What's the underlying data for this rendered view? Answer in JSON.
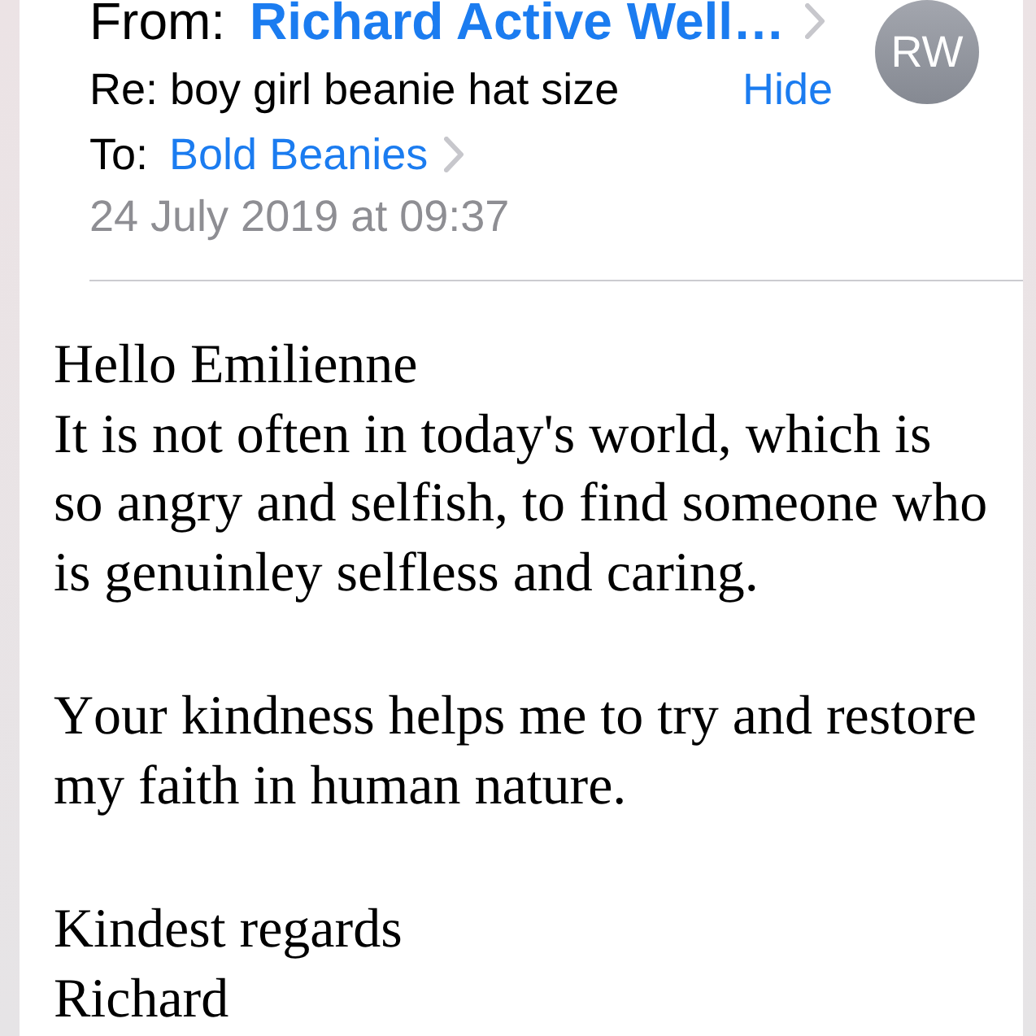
{
  "header": {
    "from": {
      "label": "From:",
      "name": "Richard Active Well…"
    },
    "subject": "Re: boy girl beanie hat size",
    "hide_button": "Hide",
    "to": {
      "label": "To:",
      "name": "Bold Beanies"
    },
    "date": "24 July 2019 at 09:37",
    "avatar": {
      "initials": "RW"
    }
  },
  "body": {
    "blocks": [
      [
        "Hello Emilienne",
        "It is not often in today's world, which is so angry and selfish, to find someone who is genuinley selfless and caring."
      ],
      [
        "Your kindness helps me to try and restore my faith in human nature."
      ],
      [
        "Kindest regards",
        "Richard"
      ]
    ]
  }
}
